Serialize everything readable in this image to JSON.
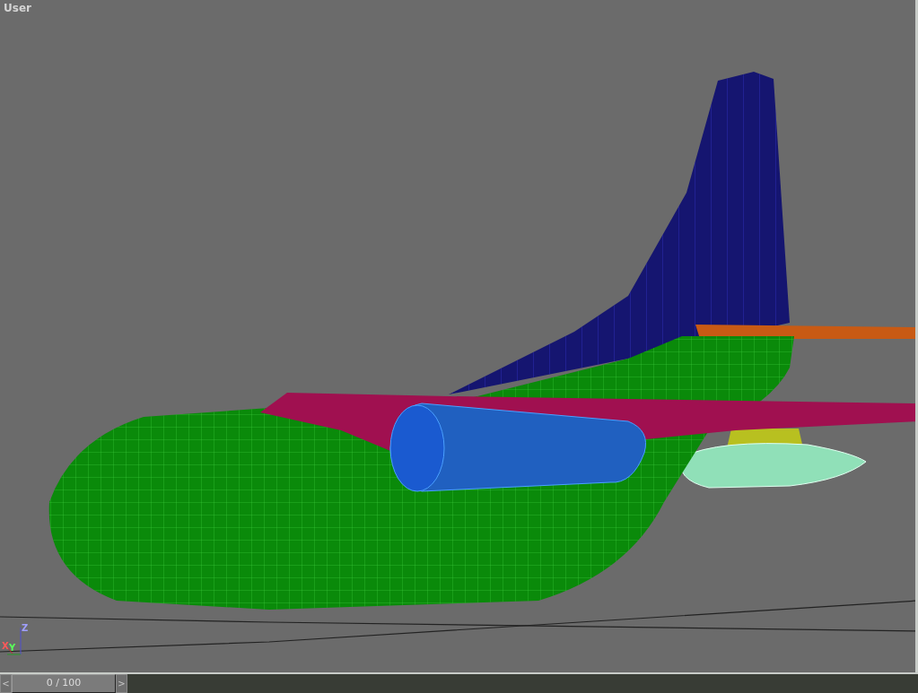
{
  "viewport": {
    "label": "User",
    "axis_labels": [
      "X",
      "Y",
      "Z"
    ]
  },
  "timeline": {
    "prev": "<",
    "frame": "0 / 100",
    "next": ">",
    "level": 0
  }
}
